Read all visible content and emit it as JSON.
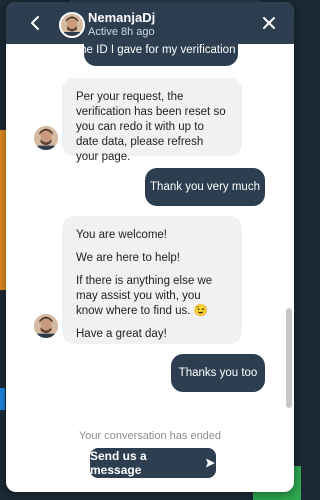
{
  "header": {
    "agent_name": "NemanjaDj",
    "status": "Active 8h ago"
  },
  "messages": [
    {
      "from": "user",
      "text": "the ID I gave for my verification ?"
    },
    {
      "from": "agent",
      "text": "Per your request, the verification has been reset so you can redo it with up to date data, please refresh your page."
    },
    {
      "from": "user",
      "text": "Thank you very much"
    },
    {
      "from": "agent",
      "lines": [
        "You are welcome!",
        "We are here to help!",
        "If there is anything else we may assist you with, you know where to find us. 😉",
        "Have a great day!"
      ]
    },
    {
      "from": "user",
      "text": "Thanks you too"
    }
  ],
  "footer": {
    "ended_text": "Your conversation has ended",
    "send_label": "Send us a message"
  },
  "colors": {
    "header": "#2c3e50",
    "sent_bubble": "#2c3e50",
    "received_bubble": "#f0f1f2"
  },
  "icons": [
    "back-arrow-icon",
    "close-icon",
    "send-arrow-icon"
  ]
}
